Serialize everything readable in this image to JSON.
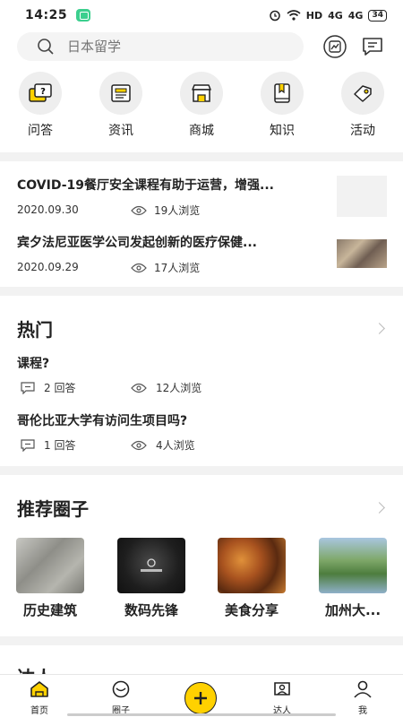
{
  "status": {
    "time": "14:25",
    "network": "HD",
    "signal1": "4G",
    "signal2": "4G",
    "battery": "34"
  },
  "search": {
    "placeholder": "日本留学"
  },
  "categories": [
    {
      "label": "问答",
      "icon": "qa-icon"
    },
    {
      "label": "资讯",
      "icon": "news-icon"
    },
    {
      "label": "商城",
      "icon": "shop-icon"
    },
    {
      "label": "知识",
      "icon": "book-icon"
    },
    {
      "label": "活动",
      "icon": "ticket-icon"
    }
  ],
  "news": [
    {
      "title": "COVID-19餐厅安全课程有助于运营，增强...",
      "date": "2020.09.30",
      "views": "19人浏览"
    },
    {
      "title": "宾夕法尼亚医学公司发起创新的医疗保健...",
      "date": "2020.09.29",
      "views": "17人浏览"
    }
  ],
  "hot": {
    "title": "热门",
    "questions": [
      {
        "title": "课程?",
        "answers": "2 回答",
        "views": "12人浏览"
      },
      {
        "title": "哥伦比亚大学有访问生项目吗?",
        "answers": "1 回答",
        "views": "4人浏览"
      }
    ]
  },
  "circles": {
    "title": "推荐圈子",
    "items": [
      {
        "label": "历史建筑",
        "color": "#9a9a95"
      },
      {
        "label": "数码先锋",
        "color": "#2b2b2b"
      },
      {
        "label": "美食分享",
        "color": "#a8521f"
      },
      {
        "label": "加州大...",
        "color": "#5a8a4a"
      }
    ]
  },
  "next_section": {
    "title": "达人"
  },
  "tabs": [
    {
      "label": "首页"
    },
    {
      "label": "圈子"
    },
    {
      "label": "达人"
    },
    {
      "label": "我"
    }
  ],
  "colors": {
    "accent": "#ffd100"
  }
}
